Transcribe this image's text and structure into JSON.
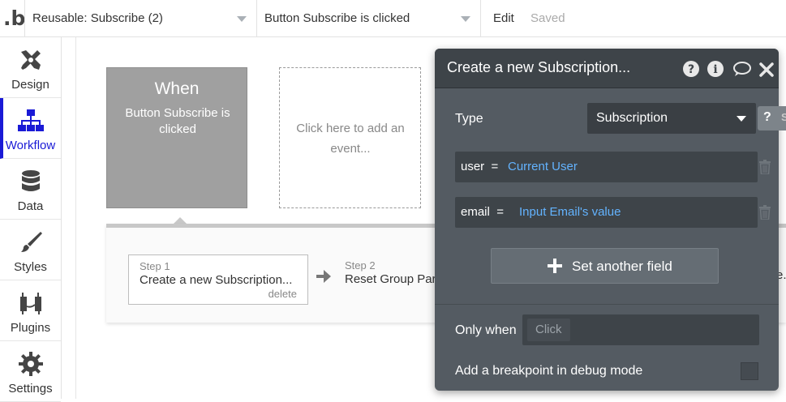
{
  "topbar": {
    "logo_text": ".b",
    "reusable_dropdown": "Reusable: Subscribe (2)",
    "event_dropdown": "Button Subscribe is clicked",
    "edit_label": "Edit",
    "saved_label": "Saved"
  },
  "sidebar": {
    "items": [
      {
        "label": "Design",
        "icon": "design-icon"
      },
      {
        "label": "Workflow",
        "icon": "workflow-icon",
        "active": true
      },
      {
        "label": "Data",
        "icon": "database-icon"
      },
      {
        "label": "Styles",
        "icon": "brush-icon"
      },
      {
        "label": "Plugins",
        "icon": "plug-icon"
      },
      {
        "label": "Settings",
        "icon": "gear-icon"
      }
    ],
    "accent": "#1a1ad6"
  },
  "workflow": {
    "when_title": "When",
    "when_event": "Button Subscribe is clicked",
    "add_event_text": "Click here to add an event...",
    "steps": [
      {
        "number": "Step 1",
        "title": "Create a new Subscription...",
        "delete_label": "delete"
      },
      {
        "number": "Step 2",
        "title": "Reset Group Par"
      }
    ],
    "truncated_tail": "e."
  },
  "modal": {
    "title": "Create a new Subscription...",
    "type_label": "Type",
    "type_value": "Subscription",
    "help_chip": {
      "q": "?",
      "s": "S"
    },
    "fields": [
      {
        "key": "user",
        "op": "=",
        "value": "Current User"
      },
      {
        "key": "email",
        "op": "=",
        "value": "Input Email's value"
      }
    ],
    "set_field_label": "Set another field",
    "only_when_label": "Only when",
    "only_when_placeholder": "Click",
    "breakpoint_label": "Add a breakpoint in debug mode",
    "colors": {
      "header": "#3e4449",
      "body": "#545b62",
      "link": "#63b3ff"
    }
  }
}
